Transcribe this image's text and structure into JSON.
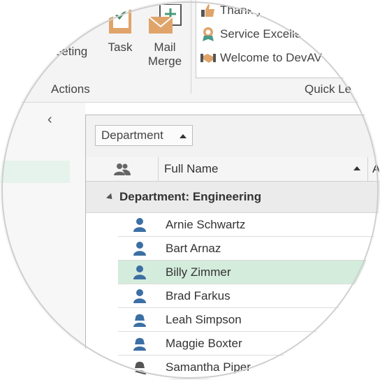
{
  "ribbon": {
    "buttons": {
      "meeting": "eeting",
      "task": "Task",
      "mail_merge_line1": "Mail",
      "mail_merge_line2": "Merge"
    },
    "groups": {
      "actions": "Actions",
      "quick_letters": "Quick Le"
    },
    "quick_letters": [
      {
        "label": "Thank y",
        "icon": "thumbs-up-icon"
      },
      {
        "label": "Service Excelle",
        "icon": "award-ribbon-icon"
      },
      {
        "label": "Welcome to DevAV",
        "icon": "handshake-icon"
      }
    ]
  },
  "nav": {
    "collapse_glyph": "‹"
  },
  "grid": {
    "group_panel_chip": "Department",
    "columns": {
      "photo_icon": "people-icon",
      "full_name": "Full Name",
      "next_col": "A"
    },
    "group_row": "Department: Engineering",
    "rows": [
      {
        "name": "Arnie Schwartz",
        "gender": "male",
        "selected": false
      },
      {
        "name": "Bart Arnaz",
        "gender": "male",
        "selected": false
      },
      {
        "name": "Billy Zimmer",
        "gender": "male",
        "selected": true
      },
      {
        "name": "Brad Farkus",
        "gender": "male",
        "selected": false
      },
      {
        "name": "Leah Simpson",
        "gender": "female",
        "selected": false
      },
      {
        "name": "Maggie Boxter",
        "gender": "female",
        "selected": false
      },
      {
        "name": "Samantha Piper",
        "gender": "female-gray",
        "selected": false
      }
    ]
  },
  "colors": {
    "accent_green_selection": "#d4ecdc",
    "person_blue": "#3c6fa4",
    "orange_icon": "#e0a46b"
  }
}
